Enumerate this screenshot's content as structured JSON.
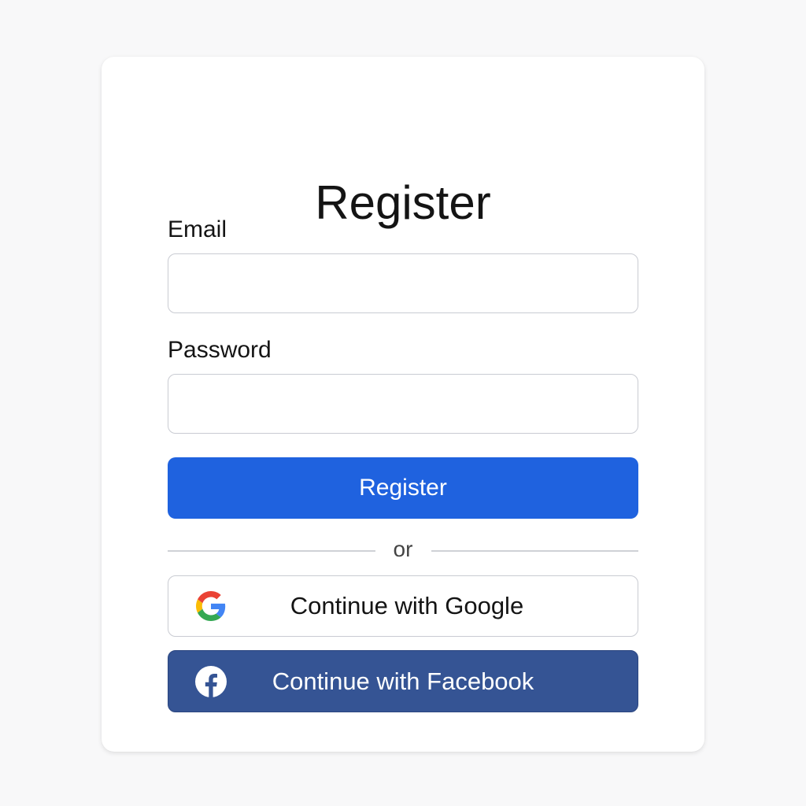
{
  "form": {
    "title": "Register",
    "email_label": "Email",
    "email_value": "",
    "password_label": "Password",
    "password_value": "",
    "register_button": "Register",
    "divider_text": "or",
    "google_button": "Continue with Google",
    "facebook_button": "Continue with Facebook"
  },
  "icons": {
    "google": "google-g-icon",
    "facebook": "facebook-f-icon"
  },
  "colors": {
    "primary": "#1f62df",
    "facebook": "#355494",
    "background": "#f8f8f9",
    "card": "#ffffff"
  }
}
